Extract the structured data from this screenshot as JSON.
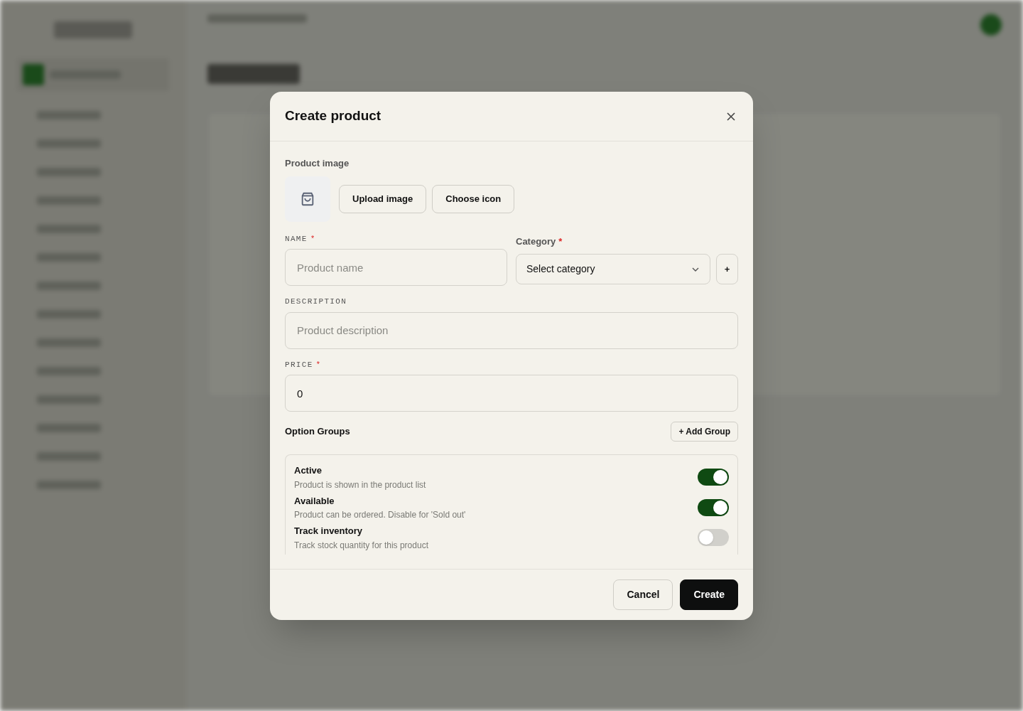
{
  "dialog": {
    "title": "Create product"
  },
  "product_image": {
    "label": "Product image",
    "buttons": [
      "Upload image",
      "Choose icon"
    ]
  },
  "name_field": {
    "label": "NAME",
    "required_mark": "*",
    "placeholder": "Product name"
  },
  "category_field": {
    "label": "Category",
    "required_mark": "*",
    "value": "Select category",
    "add_label": "+"
  },
  "description_field": {
    "label": "DESCRIPTION",
    "placeholder": "Product description"
  },
  "price_field": {
    "label": "PRICE",
    "required_mark": "*",
    "value": "0"
  },
  "option_groups": {
    "title": "Option Groups",
    "add_button": "+ Add Group"
  },
  "toggles": [
    {
      "label": "Active",
      "description": "Product is shown in the product list",
      "on": true
    },
    {
      "label": "Available",
      "description": "Product can be ordered. Disable for 'Sold out'",
      "on": true
    },
    {
      "label": "Track inventory",
      "description": "Track stock quantity for this product",
      "on": false
    }
  ],
  "footer_buttons": [
    {
      "label": "Cancel",
      "kind": "secondary"
    },
    {
      "label": "Create",
      "kind": "primary"
    }
  ]
}
